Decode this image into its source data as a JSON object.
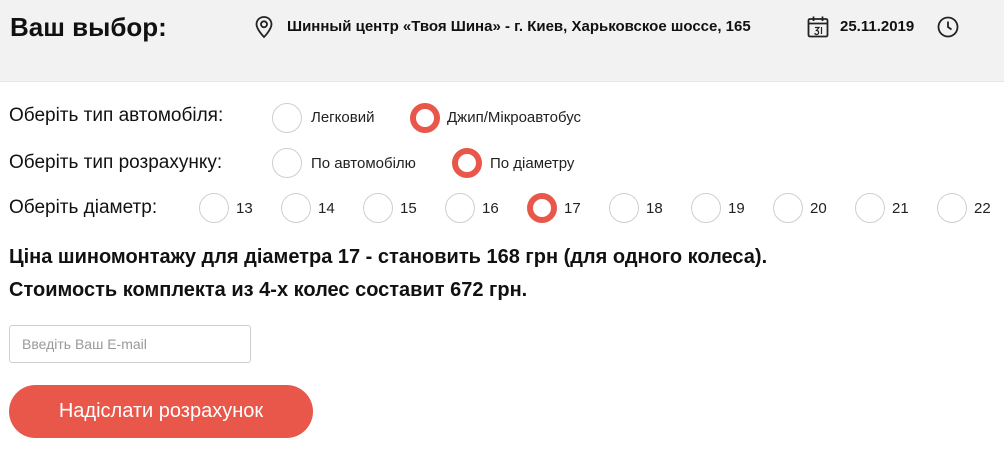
{
  "header": {
    "title": "Ваш выбор:",
    "location": "Шинный центр «Твоя Шина» - г. Киев, Харьковское шоссе, 165",
    "date": "25.11.2019",
    "icons": {
      "location": "map-pin-icon",
      "date": "calendar-icon",
      "time": "clock-icon"
    }
  },
  "car_type": {
    "label": "Оберіть тип автомобіля:",
    "options": [
      {
        "label": "Легковий",
        "checked": false
      },
      {
        "label": "Джип/Мікроавтобус",
        "checked": true
      }
    ]
  },
  "calc_type": {
    "label": "Оберіть тип розрахунку:",
    "options": [
      {
        "label": "По автомобілю",
        "checked": false
      },
      {
        "label": "По діаметру",
        "checked": true
      }
    ]
  },
  "diameter": {
    "label": "Оберіть діаметр:",
    "options": [
      {
        "label": "13",
        "checked": false
      },
      {
        "label": "14",
        "checked": false
      },
      {
        "label": "15",
        "checked": false
      },
      {
        "label": "16",
        "checked": false
      },
      {
        "label": "17",
        "checked": true
      },
      {
        "label": "18",
        "checked": false
      },
      {
        "label": "19",
        "checked": false
      },
      {
        "label": "20",
        "checked": false
      },
      {
        "label": "21",
        "checked": false
      },
      {
        "label": "22",
        "checked": false
      }
    ]
  },
  "result": {
    "line1": "Ціна шиномонтажу для діаметра 17 - становить 168 грн (для одного колеса).",
    "line2": "Стоимость комплекта из 4-х колес составит 672 грн."
  },
  "form": {
    "email_placeholder": "Введіть Ваш E-mail",
    "email_value": "",
    "submit_label": "Надіслати розрахунок"
  },
  "colors": {
    "accent": "#e8574a",
    "header_bg": "#f2f2f2"
  }
}
